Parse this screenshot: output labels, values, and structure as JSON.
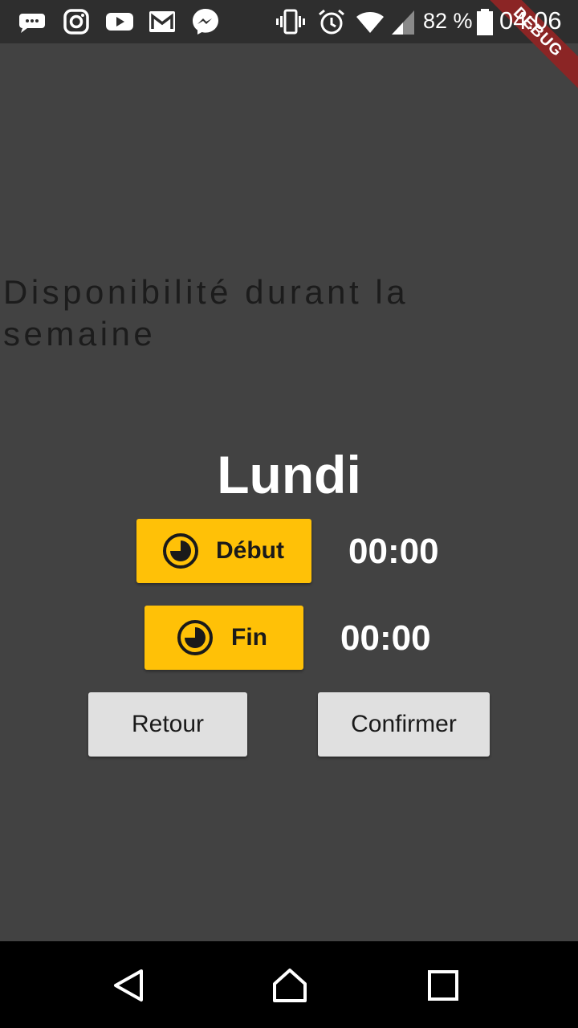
{
  "status_bar": {
    "battery_percent": "82 %",
    "time": "04:06",
    "debug_label": "DEBUG",
    "icons": [
      "messages-icon",
      "instagram-icon",
      "youtube-icon",
      "gmail-icon",
      "messenger-icon",
      "vibrate-icon",
      "alarm-icon",
      "wifi-icon",
      "signal-icon",
      "battery-icon"
    ]
  },
  "page": {
    "heading": "Disponibilité durant la semaine",
    "day": "Lundi"
  },
  "start": {
    "label": "Début",
    "time": "00:00"
  },
  "end": {
    "label": "Fin",
    "time": "00:00"
  },
  "actions": {
    "back_label": "Retour",
    "confirm_label": "Confirmer"
  },
  "nav_bar": {
    "icons": [
      "back-icon",
      "home-icon",
      "recents-icon"
    ]
  },
  "colors": {
    "background": "#424242",
    "accent": "#ffc107",
    "button": "#e0e0e0"
  }
}
